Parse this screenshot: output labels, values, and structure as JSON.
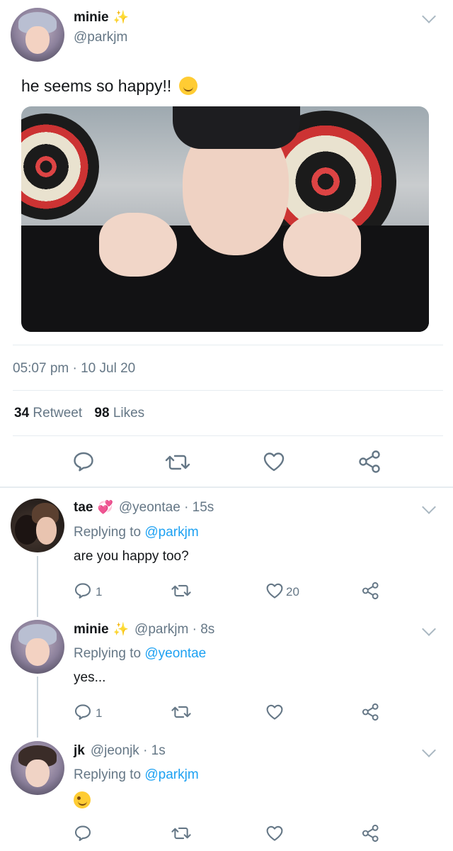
{
  "main_tweet": {
    "author_name": "minie",
    "author_handle": "@parkjm",
    "text": "he seems so happy!!",
    "timestamp": "05:07 pm · 10 Jul 20",
    "retweet_count": "34",
    "retweet_label": "Retweet",
    "like_count": "98",
    "like_label": "Likes"
  },
  "replies": [
    {
      "name": "tae",
      "handle_time": "@yeontae · 15s",
      "replying_prefix": "Replying to",
      "replying_to": "@parkjm",
      "text": "are you happy too?",
      "reply_count": "1",
      "like_count": "20"
    },
    {
      "name": "minie",
      "handle_time": "@parkjm · 8s",
      "replying_prefix": "Replying to",
      "replying_to": "@yeontae",
      "text": "yes...",
      "reply_count": "1",
      "like_count": ""
    },
    {
      "name": "jk",
      "handle_time": "@jeonjk · 1s",
      "replying_prefix": "Replying to",
      "replying_to": "@parkjm",
      "text": "",
      "reply_count": "",
      "like_count": ""
    }
  ],
  "colors": {
    "link": "#1da1f2",
    "secondary_text": "#657786",
    "icon": "#657786",
    "divider": "#e6ecf0"
  }
}
